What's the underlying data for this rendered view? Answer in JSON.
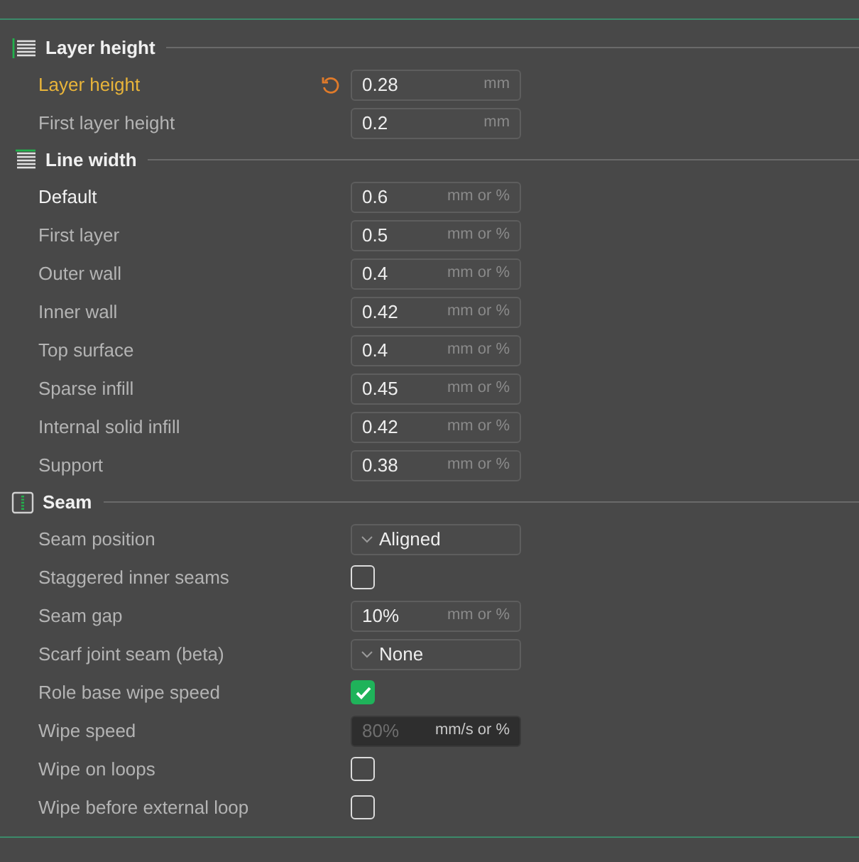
{
  "sections": [
    {
      "title": "Layer height",
      "rows": [
        {
          "kind": "number",
          "label": "Layer height",
          "value": "0.28",
          "unit": "mm",
          "modified": true,
          "disabled": false
        },
        {
          "kind": "number",
          "label": "First layer height",
          "value": "0.2",
          "unit": "mm",
          "modified": false,
          "strong": false,
          "disabled": false
        }
      ]
    },
    {
      "title": "Line width",
      "rows": [
        {
          "kind": "number",
          "label": "Default",
          "value": "0.6",
          "unit": "mm or %",
          "modified": false,
          "strong": true,
          "disabled": false
        },
        {
          "kind": "number",
          "label": "First layer",
          "value": "0.5",
          "unit": "mm or %",
          "modified": false,
          "strong": false,
          "disabled": false
        },
        {
          "kind": "number",
          "label": "Outer wall",
          "value": "0.4",
          "unit": "mm or %",
          "modified": false,
          "strong": false,
          "disabled": false
        },
        {
          "kind": "number",
          "label": "Inner wall",
          "value": "0.42",
          "unit": "mm or %",
          "modified": false,
          "strong": false,
          "disabled": false
        },
        {
          "kind": "number",
          "label": "Top surface",
          "value": "0.4",
          "unit": "mm or %",
          "modified": false,
          "strong": false,
          "disabled": false
        },
        {
          "kind": "number",
          "label": "Sparse infill",
          "value": "0.45",
          "unit": "mm or %",
          "modified": false,
          "strong": false,
          "disabled": false
        },
        {
          "kind": "number",
          "label": "Internal solid infill",
          "value": "0.42",
          "unit": "mm or %",
          "modified": false,
          "strong": false,
          "disabled": false
        },
        {
          "kind": "number",
          "label": "Support",
          "value": "0.38",
          "unit": "mm or %",
          "modified": false,
          "strong": false,
          "disabled": false
        }
      ]
    },
    {
      "title": "Seam",
      "rows": [
        {
          "kind": "select",
          "label": "Seam position",
          "value": "Aligned",
          "modified": false,
          "strong": false
        },
        {
          "kind": "checkbox",
          "label": "Staggered inner seams",
          "checked": false,
          "modified": false,
          "strong": false
        },
        {
          "kind": "number",
          "label": "Seam gap",
          "value": "10%",
          "unit": "mm or %",
          "modified": false,
          "strong": false,
          "disabled": false
        },
        {
          "kind": "select",
          "label": "Scarf joint seam (beta)",
          "value": "None",
          "modified": false,
          "strong": false
        },
        {
          "kind": "checkbox",
          "label": "Role base wipe speed",
          "checked": true,
          "modified": false,
          "strong": false
        },
        {
          "kind": "number",
          "label": "Wipe speed",
          "value": "80%",
          "unit": "mm/s or %",
          "modified": false,
          "strong": false,
          "disabled": true
        },
        {
          "kind": "checkbox",
          "label": "Wipe on loops",
          "checked": false,
          "modified": false,
          "strong": false
        },
        {
          "kind": "checkbox",
          "label": "Wipe before external loop",
          "checked": false,
          "modified": false,
          "strong": false
        }
      ]
    }
  ]
}
